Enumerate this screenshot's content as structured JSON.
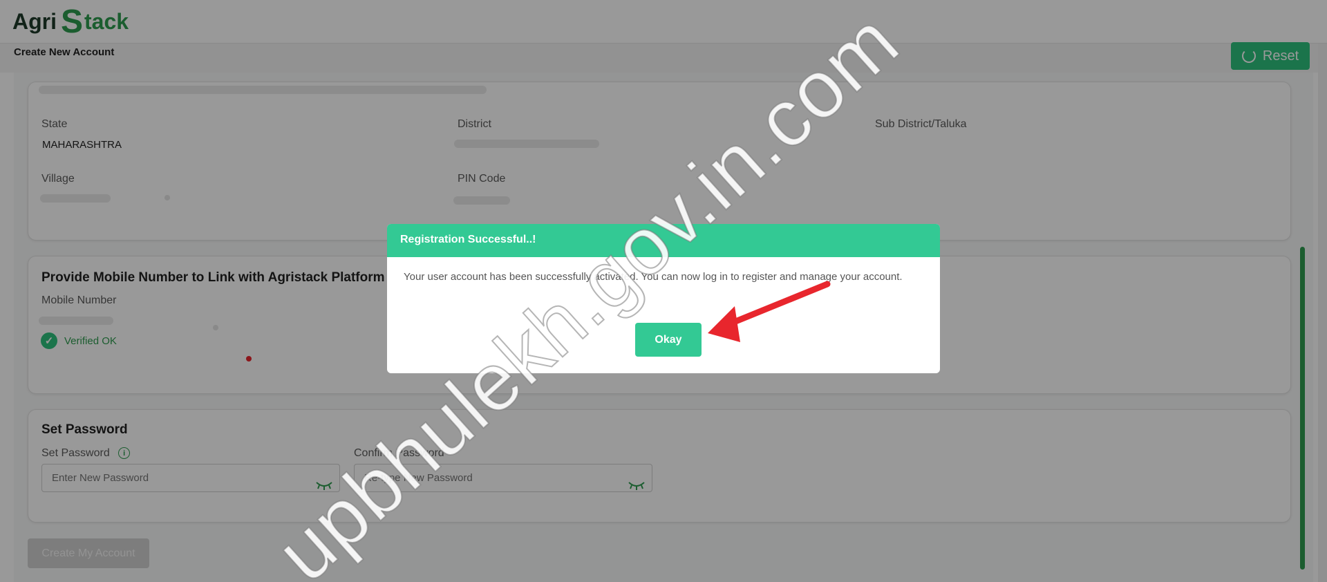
{
  "header": {
    "logo_agri": "Agri",
    "logo_s": "S",
    "logo_tack": "tack",
    "page_title": "Create New Account",
    "reset_label": "Reset"
  },
  "location": {
    "state_label": "State",
    "state_value": "MAHARASHTRA",
    "district_label": "District",
    "subdistrict_label": "Sub District/Taluka",
    "village_label": "Village",
    "pin_label": "PIN Code"
  },
  "mobile": {
    "heading": "Provide Mobile Number to Link with Agristack Platform",
    "label": "Mobile Number",
    "verified_text": "Verified OK"
  },
  "password": {
    "heading": "Set Password",
    "set_label": "Set Password",
    "set_placeholder": "Enter New Password",
    "confirm_label": "Confirm Password",
    "confirm_placeholder": "Re-type New Password"
  },
  "create_label": "Create My Account",
  "modal": {
    "title": "Registration Successful..!",
    "message": "Your user account has been successfully activated. You can now log in to register and manage your account.",
    "okay_label": "Okay"
  },
  "watermark": "upbhulekh.gov.in.com",
  "colors": {
    "primary_green": "#33c994",
    "dark_green": "#2e9b4f",
    "arrow_red": "#e8262d"
  }
}
